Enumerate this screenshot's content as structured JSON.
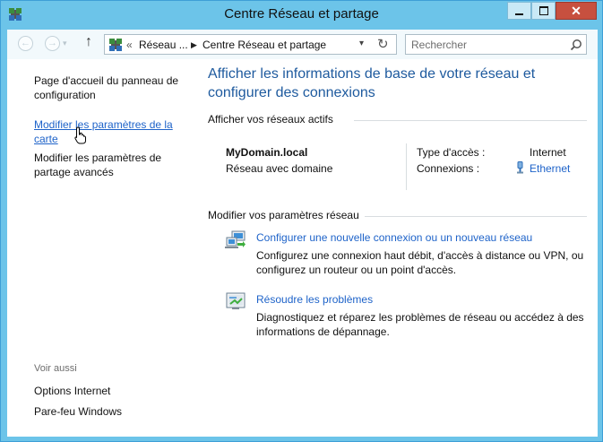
{
  "window": {
    "title": "Centre Réseau et partage"
  },
  "navbar": {
    "address": {
      "overflow": "«",
      "segments": [
        "Réseau ...",
        "Centre Réseau et partage"
      ],
      "separator": "▶"
    },
    "search": {
      "placeholder": "Rechercher"
    }
  },
  "sidebar": {
    "links": [
      "Page d'accueil du panneau de configuration",
      "Modifier les paramètres de la carte",
      "Modifier les paramètres de partage avancés"
    ],
    "see_also_label": "Voir aussi",
    "see_also": [
      "Options Internet",
      "Pare-feu Windows"
    ]
  },
  "main": {
    "title": "Afficher les informations de base de votre réseau et configurer des connexions",
    "active_networks_heading": "Afficher vos réseaux actifs",
    "network": {
      "name": "MyDomain.local",
      "type": "Réseau avec domaine",
      "access_label": "Type d'accès :",
      "access_value": "Internet",
      "connections_label": "Connexions :",
      "connection": "Ethernet"
    },
    "modify_heading": "Modifier vos paramètres réseau",
    "tasks": [
      {
        "label": "Configurer une nouvelle connexion ou un nouveau réseau",
        "description": "Configurez une connexion haut débit, d'accès à distance ou VPN, ou configurez un routeur ou un point d'accès."
      },
      {
        "label": "Résoudre les problèmes",
        "description": "Diagnostiquez et réparez les problèmes de réseau ou accédez à des informations de dépannage."
      }
    ]
  },
  "colors": {
    "accent_link": "#1e63c9",
    "title_blue": "#1e5a9e",
    "frame": "#6cc4e9",
    "close_red": "#c7503f"
  }
}
